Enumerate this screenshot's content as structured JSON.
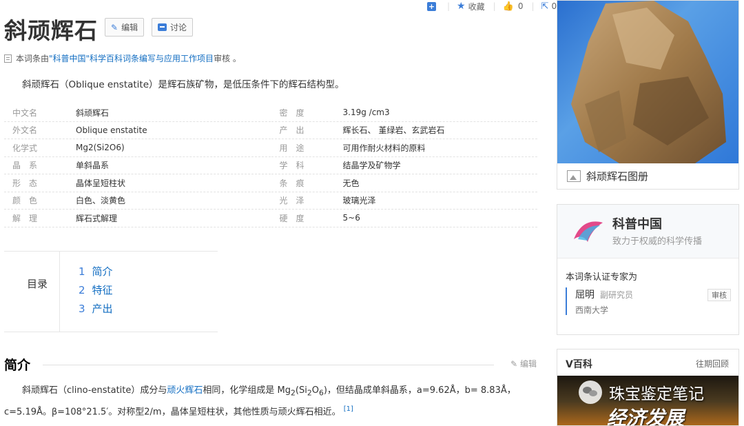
{
  "topbar": {
    "favorite_label": "收藏",
    "like_count": "0",
    "share_count": "0"
  },
  "page_title": "斜顽辉石",
  "toolbar": {
    "edit_label": "编辑",
    "discuss_label": "讨论"
  },
  "audit": {
    "prefix": "本词条由",
    "link": "\"科普中国\"科学百科词条编写与应用工作项目",
    "suffix": " 审核 。"
  },
  "lead_text": "斜顽辉石（Oblique enstatite）是辉石族矿物，是低压条件下的辉石结构型。",
  "info_rows": [
    {
      "k1": "中文名",
      "v1": "斜顽辉石",
      "k2": "密　度",
      "v2": "3.19g /cm3"
    },
    {
      "k1": "外文名",
      "v1": "Oblique enstatite",
      "k2": "产　出",
      "v2": "辉长石、 堇绿岩、玄武岩石"
    },
    {
      "k1": "化学式",
      "v1": "Mg2(Si2O6)",
      "k2": "用　途",
      "v2": "可用作耐火材料的原料"
    },
    {
      "k1": "晶　系",
      "v1": "单斜晶系",
      "k2": "学　科",
      "v2": "结晶学及矿物学"
    },
    {
      "k1": "形　态",
      "v1": "晶体呈短柱状",
      "k2": "条　痕",
      "v2": "无色"
    },
    {
      "k1": "颜　色",
      "v1": "白色、淡黄色",
      "k2": "光　泽",
      "v2": "玻璃光泽"
    },
    {
      "k1": "解　理",
      "v1": "辉石式解理",
      "k2": "硬　度",
      "v2": "5~6"
    }
  ],
  "toc": {
    "label": "目录",
    "items": [
      {
        "num": "1",
        "text": "简介"
      },
      {
        "num": "2",
        "text": "特征"
      },
      {
        "num": "3",
        "text": "产出"
      }
    ]
  },
  "section": {
    "heading": "简介",
    "edit_label": "编辑"
  },
  "paragraph": {
    "p1": "斜顽辉石（clino-enstatite）成分与",
    "link": "顽火辉石",
    "p2": "相同，化学组成是 Mg",
    "sub1": "2",
    "p3": "(Si",
    "sub2": "2",
    "p4": "O",
    "sub3": "6",
    "p5": ")，但结晶成单斜晶系，a=9.62Å，b= 8.83Å，c=5.19Å。β=108°21.5′。对称型2/m，晶体呈短柱状，其他性质与顽火辉石相近。",
    "ref": "[1]"
  },
  "sidebar": {
    "album_caption": "斜顽辉石图册",
    "kp_title": "科普中国",
    "kp_subtitle": "致力于权威的科学传播",
    "expert_label": "本词条认证专家为",
    "expert_name": "屈明",
    "expert_role": "副研究员",
    "expert_org": "西南大学",
    "expert_badge": "审核",
    "vbaike_title": "V百科",
    "vbaike_more": "往期回顾",
    "vbaike_banner": "经济发展"
  },
  "watermark": "珠宝鉴定笔记"
}
